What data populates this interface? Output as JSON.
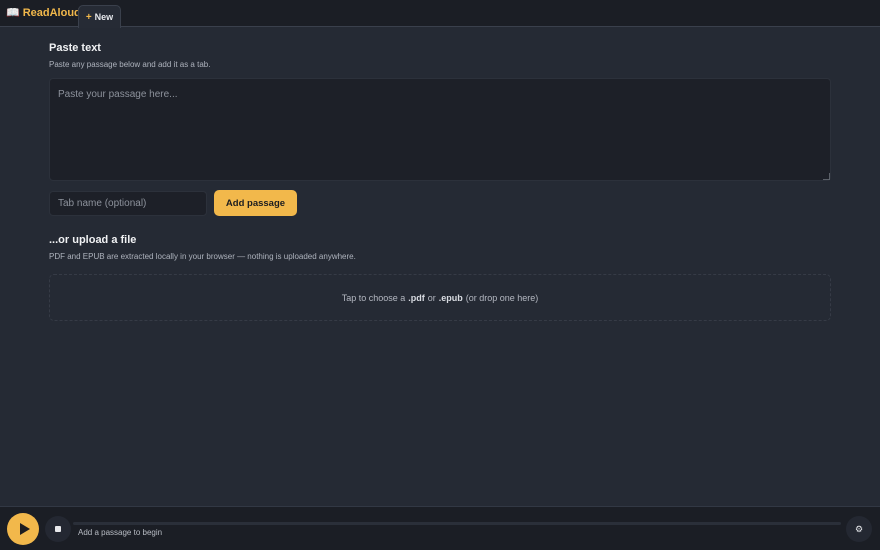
{
  "app": {
    "icon": "open-book-icon",
    "title": "ReadAloud"
  },
  "tabs": {
    "new_label": "New",
    "new_icon": "plus-icon"
  },
  "paste": {
    "heading": "Paste text",
    "subtitle": "Paste any passage below and add it as a tab.",
    "textarea_placeholder": "Paste your passage here...",
    "textarea_value": "",
    "tabname_placeholder": "Tab name (optional)",
    "tabname_value": "",
    "add_button": "Add passage"
  },
  "upload": {
    "heading": "...or upload a file",
    "subtitle": "PDF and EPUB are extracted locally in your browser — nothing is uploaded anywhere.",
    "drop_prefix": "Tap to choose a",
    "ext_pdf": ".pdf",
    "drop_or": "or",
    "ext_epub": ".epub",
    "drop_suffix": "(or drop one here)"
  },
  "player": {
    "play_icon": "play-icon",
    "stop_icon": "stop-icon",
    "settings_icon": "gear-icon",
    "status": "Add a passage to begin",
    "progress": 0
  },
  "colors": {
    "accent": "#f2b84b",
    "background": "#252a34",
    "topbar": "#1b1e25"
  }
}
